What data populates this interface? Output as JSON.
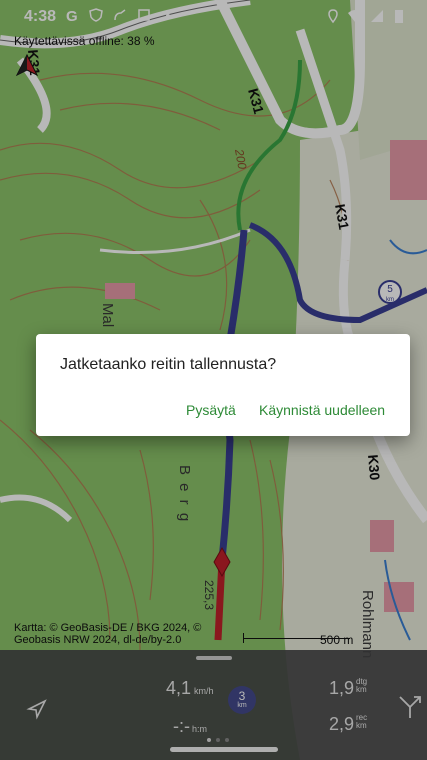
{
  "status_bar": {
    "time": "4:38"
  },
  "map": {
    "offline_notice": "Käytettävissä offline: 38 %",
    "labels": {
      "k31_top": "K31",
      "k31_right": "K31",
      "k31_left": "K31",
      "elev_200": "200",
      "k30": "K30",
      "berg": "B e r g",
      "mal": "Mal",
      "elev_225": "225,3",
      "rohlmann": "Rohlmann",
      "km_badge_num": "5",
      "km_badge_unit": "km"
    },
    "attribution_line1": "Kartta: © GeoBasis-DE / BKG 2024, ©",
    "attribution_line2": "Geobasis NRW 2024, dl-de/by-2.0",
    "scale_label": "500 m"
  },
  "dialog": {
    "message": "Jatketaanko reitin tallennusta?",
    "stop_label": "Pysäytä",
    "restart_label": "Käynnistä uudelleen"
  },
  "panel": {
    "speed_value": "4,1",
    "speed_unit": "km/h",
    "time_value": "-:-",
    "time_unit": "h:m",
    "badge_value": "3",
    "badge_unit": "km",
    "distance_value": "1,9",
    "distance_unit_top": "dtg",
    "distance_unit_bottom": "km",
    "recorded_value": "2,9",
    "recorded_unit_top": "rec",
    "recorded_unit_bottom": "km"
  },
  "colors": {
    "map_green": "#8cc46a",
    "map_white": "#eef0e4",
    "track_blue": "#3a3f93",
    "track_red": "#c0202a",
    "dialog_accent": "#2d8a36"
  }
}
